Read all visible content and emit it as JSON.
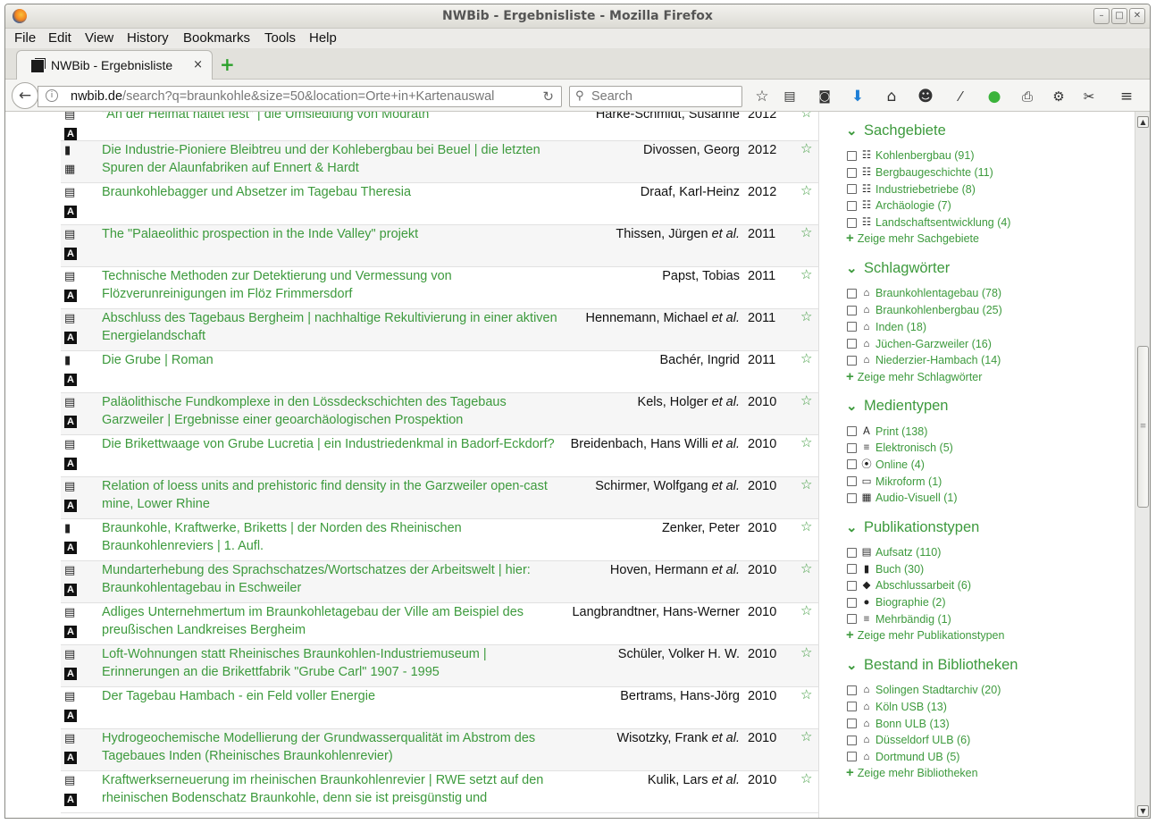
{
  "window": {
    "title": "NWBib - Ergebnisliste - Mozilla Firefox"
  },
  "menu": [
    "File",
    "Edit",
    "View",
    "History",
    "Bookmarks",
    "Tools",
    "Help"
  ],
  "tab": {
    "label": "NWBib - Ergebnisliste",
    "close": "×",
    "new": "+"
  },
  "url": {
    "domain": "nwbib.de",
    "path": "/search?q=braunkohle&size=50&location=Orte+in+Kartenauswal",
    "reload": "↻"
  },
  "search": {
    "placeholder": "Search"
  },
  "results": [
    {
      "t": "\"An der Heimat haltet fest\" | die Umsiedlung von Mödrath",
      "a": "Harke-Schmidt, Susanne",
      "e": "",
      "y": "2012",
      "i1": "doc",
      "i2": "A"
    },
    {
      "t": "Die Industrie-Pioniere Bleibtreu und der Kohlebergbau bei Beuel | die letzten Spuren der Alaunfabriken auf Ennert & Hardt",
      "a": "Divossen, Georg",
      "e": "",
      "y": "2012",
      "i1": "book",
      "i2": "film"
    },
    {
      "t": "Braunkohlebagger und Absetzer im Tagebau Theresia",
      "a": "Draaf, Karl-Heinz",
      "e": "",
      "y": "2012",
      "i1": "doc",
      "i2": "A"
    },
    {
      "t": "The \"Palaeolithic prospection in the Inde Valley\" projekt",
      "a": "Thissen, Jürgen",
      "e": "et al.",
      "y": "2011",
      "i1": "doc",
      "i2": "A"
    },
    {
      "t": "Technische Methoden zur Detektierung und Vermessung von Flözverunreinigungen im Flöz Frimmersdorf",
      "a": "Papst, Tobias",
      "e": "",
      "y": "2011",
      "i1": "doc",
      "i2": "A"
    },
    {
      "t": "Abschluss des Tagebaus Bergheim | nachhaltige Rekultivierung in einer aktiven Energielandschaft",
      "a": "Hennemann, Michael",
      "e": "et al.",
      "y": "2011",
      "i1": "doc",
      "i2": "A"
    },
    {
      "t": "Die Grube | Roman",
      "a": "Bachér, Ingrid",
      "e": "",
      "y": "2011",
      "i1": "book",
      "i2": "A"
    },
    {
      "t": "Paläolithische Fundkomplexe in den Lössdeckschichten des Tagebaus Garzweiler | Ergebnisse einer geoarchäologischen Prospektion",
      "a": "Kels, Holger",
      "e": "et al.",
      "y": "2010",
      "i1": "doc",
      "i2": "A"
    },
    {
      "t": "Die Brikettwaage von Grube Lucretia | ein Industriedenkmal in Badorf-Eckdorf?",
      "a": "Breidenbach, Hans Willi",
      "e": "et al.",
      "y": "2010",
      "i1": "doc",
      "i2": "A"
    },
    {
      "t": "Relation of loess units and prehistoric find density in the Garzweiler open-cast mine, Lower Rhine",
      "a": "Schirmer, Wolfgang",
      "e": "et al.",
      "y": "2010",
      "i1": "doc",
      "i2": "A"
    },
    {
      "t": "Braunkohle, Kraftwerke, Briketts | der Norden des Rheinischen Braunkohlenreviers | 1. Aufl.",
      "a": "Zenker, Peter",
      "e": "",
      "y": "2010",
      "i1": "book",
      "i2": "A"
    },
    {
      "t": "Mundarterhebung des Sprachschatzes/Wortschatzes der Arbeitswelt | hier: Braunkohlentagebau in Eschweiler",
      "a": "Hoven, Hermann",
      "e": "et al.",
      "y": "2010",
      "i1": "doc",
      "i2": "A"
    },
    {
      "t": "Adliges Unternehmertum im Braunkohletagebau der Ville am Beispiel des preußischen Landkreises Bergheim",
      "a": "Langbrandtner, Hans-Werner",
      "e": "",
      "y": "2010",
      "i1": "doc",
      "i2": "A"
    },
    {
      "t": "Loft-Wohnungen statt Rheinisches Braunkohlen-Industriemuseum | Erinnerungen an die Brikettfabrik \"Grube Carl\" 1907 - 1995",
      "a": "Schüler, Volker H. W.",
      "e": "",
      "y": "2010",
      "i1": "doc",
      "i2": "A"
    },
    {
      "t": "Der Tagebau Hambach - ein Feld voller Energie",
      "a": "Bertrams, Hans-Jörg",
      "e": "",
      "y": "2010",
      "i1": "doc",
      "i2": "A"
    },
    {
      "t": "Hydrogeochemische Modellierung der Grundwasserqualität im Abstrom des Tagebaues Inden (Rheinisches Braunkohlenrevier)",
      "a": "Wisotzky, Frank",
      "e": "et al.",
      "y": "2010",
      "i1": "doc",
      "i2": "A"
    },
    {
      "t": "Kraftwerkserneuerung im rheinischen Braunkohlenrevier | RWE setzt auf den rheinischen Bodenschatz Braunkohle, denn sie ist preisgünstig und",
      "a": "Kulik, Lars",
      "e": "et al.",
      "y": "2010",
      "i1": "doc",
      "i2": "A"
    }
  ],
  "facets": [
    {
      "title": "Sachgebiete",
      "items": [
        {
          "icon": "☷",
          "label": "Kohlenbergbau (91)"
        },
        {
          "icon": "☷",
          "label": "Bergbaugeschichte (11)"
        },
        {
          "icon": "☷",
          "label": "Industriebetriebe (8)"
        },
        {
          "icon": "☷",
          "label": "Archäologie (7)"
        },
        {
          "icon": "☷",
          "label": "Landschaftsentwicklung (4)"
        }
      ],
      "more": "Zeige mehr Sachgebiete"
    },
    {
      "title": "Schlagwörter",
      "items": [
        {
          "icon": "⌂",
          "label": "Braunkohlentagebau (78)"
        },
        {
          "icon": "⌂",
          "label": "Braunkohlenbergbau (25)"
        },
        {
          "icon": "⌂",
          "label": "Inden (18)"
        },
        {
          "icon": "⌂",
          "label": "Jüchen-Garzweiler (16)"
        },
        {
          "icon": "⌂",
          "label": "Niederzier-Hambach (14)"
        }
      ],
      "more": "Zeige mehr Schlagwörter"
    },
    {
      "title": "Medientypen",
      "items": [
        {
          "icon": "A",
          "label": "Print (138)"
        },
        {
          "icon": "≡",
          "label": "Elektronisch (5)"
        },
        {
          "icon": "⦿",
          "label": "Online (4)"
        },
        {
          "icon": "▭",
          "label": "Mikroform (1)"
        },
        {
          "icon": "▦",
          "label": "Audio-Visuell (1)"
        }
      ],
      "more": ""
    },
    {
      "title": "Publikationstypen",
      "items": [
        {
          "icon": "▤",
          "label": "Aufsatz (110)"
        },
        {
          "icon": "▮",
          "label": "Buch (30)"
        },
        {
          "icon": "◆",
          "label": "Abschlussarbeit (6)"
        },
        {
          "icon": "●",
          "label": "Biographie (2)"
        },
        {
          "icon": "≡",
          "label": "Mehrbändig (1)"
        }
      ],
      "more": "Zeige mehr Publikationstypen"
    },
    {
      "title": "Bestand in Bibliotheken",
      "items": [
        {
          "icon": "⌂",
          "label": "Solingen Stadtarchiv (20)"
        },
        {
          "icon": "⌂",
          "label": "Köln USB (13)"
        },
        {
          "icon": "⌂",
          "label": "Bonn ULB (13)"
        },
        {
          "icon": "⌂",
          "label": "Düsseldorf ULB (6)"
        },
        {
          "icon": "⌂",
          "label": "Dortmund UB (5)"
        }
      ],
      "more": "Zeige mehr Bibliotheken"
    }
  ]
}
